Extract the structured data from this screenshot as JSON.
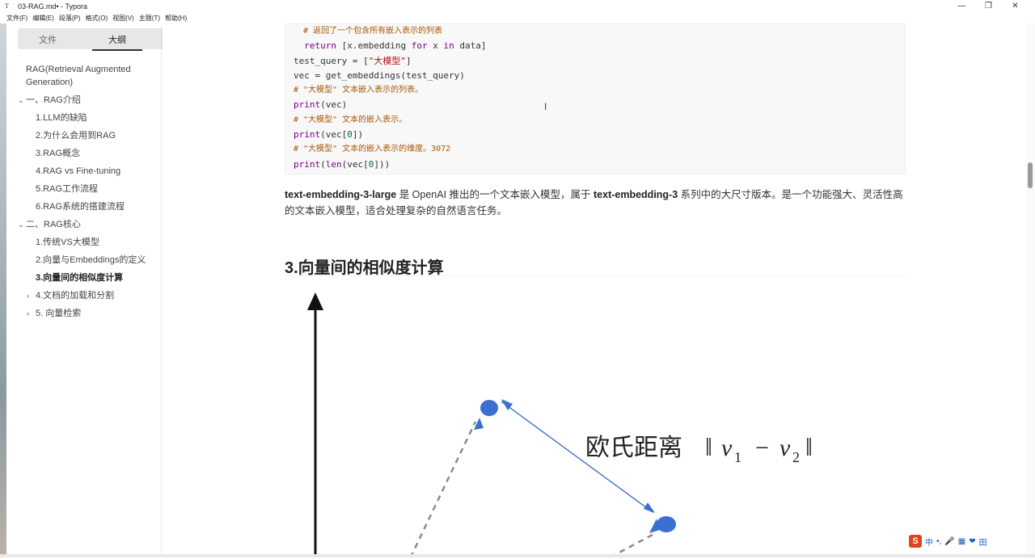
{
  "window": {
    "title": "03-RAG.md• - Typora",
    "controls": [
      "—",
      "❐",
      "✕"
    ]
  },
  "menu": [
    "文件(F)",
    "编辑(E)",
    "段落(P)",
    "格式(O)",
    "视图(V)",
    "主题(T)",
    "帮助(H)"
  ],
  "sidebar": {
    "tab_files": "文件",
    "tab_outline": "大纲",
    "items": [
      {
        "label": "RAG(Retrieval Augmented Generation)",
        "level": 0,
        "arrow": ""
      },
      {
        "label": "一、RAG介绍",
        "level": 0,
        "arrow": "⌄"
      },
      {
        "label": "1.LLM的缺陷",
        "level": 1,
        "arrow": ""
      },
      {
        "label": "2.为什么会用到RAG",
        "level": 1,
        "arrow": ""
      },
      {
        "label": "3.RAG概念",
        "level": 1,
        "arrow": ""
      },
      {
        "label": "4.RAG vs Fine-tuning",
        "level": 1,
        "arrow": ""
      },
      {
        "label": "5.RAG工作流程",
        "level": 1,
        "arrow": ""
      },
      {
        "label": "6.RAG系统的搭建流程",
        "level": 1,
        "arrow": ""
      },
      {
        "label": "二、RAG核心",
        "level": 0,
        "arrow": "⌄"
      },
      {
        "label": "1.传统VS大模型",
        "level": 1,
        "arrow": ""
      },
      {
        "label": "2.向量与Embeddings的定义",
        "level": 1,
        "arrow": ""
      },
      {
        "label": "3.向量间的相似度计算",
        "level": 1,
        "arrow": "",
        "active": true
      },
      {
        "label": "4.文档的加载和分割",
        "level": 1,
        "arrow": "›"
      },
      {
        "label": "5. 向量检索",
        "level": 1,
        "arrow": "›"
      }
    ],
    "footer_left": "‹",
    "footer_right": "</>"
  },
  "code": {
    "lines": [
      {
        "type": "comment",
        "text": "  # 返回了一个包含所有嵌入表示的列表"
      },
      {
        "type": "return",
        "kw": "  return",
        "rest1": " [x.embedding ",
        "kw2": "for",
        "rest2": " x ",
        "kw3": "in",
        "rest3": " data]"
      },
      {
        "type": "assign_str",
        "pre": "test_query = [",
        "str": "\"大模型\"",
        "post": "]"
      },
      {
        "type": "plain",
        "text": "vec = get_embeddings(test_query)"
      },
      {
        "type": "comment",
        "text": "# \"大模型\" 文本嵌入表示的列表。"
      },
      {
        "type": "call",
        "kw": "print",
        "rest": "(vec)"
      },
      {
        "type": "comment",
        "text": "# \"大模型\" 文本的嵌入表示。"
      },
      {
        "type": "call_num",
        "kw": "print",
        "pre": "(vec[",
        "num": "0",
        "post": "])"
      },
      {
        "type": "comment",
        "text": "# \"大模型\" 文本的嵌入表示的维度。3072"
      },
      {
        "type": "call2_num",
        "kw": "print",
        "pre": "(",
        "kw2": "len",
        "mid": "(vec[",
        "num": "0",
        "post": "]))"
      }
    ]
  },
  "paragraph": {
    "bold1": "text-embedding-3-large",
    "text1": " 是 OpenAI 推出的一个文本嵌入模型，属于 ",
    "bold2": "text-embedding-3",
    "text2": " 系列中的大尺寸版本。是一个功能强大、灵活性高的文本嵌入模型，适合处理复杂的自然语言任务。"
  },
  "heading": "3.向量间的相似度计算",
  "figure": {
    "label_cn": "欧氏距离",
    "label_v1": "v",
    "label_sub1": "1",
    "label_v2": "v",
    "label_sub2": "2",
    "point_color": "#3b6fd1"
  },
  "ime": {
    "logo": "S",
    "items": [
      "中",
      "•,",
      "🎤",
      "▦",
      "❤",
      "田"
    ]
  }
}
